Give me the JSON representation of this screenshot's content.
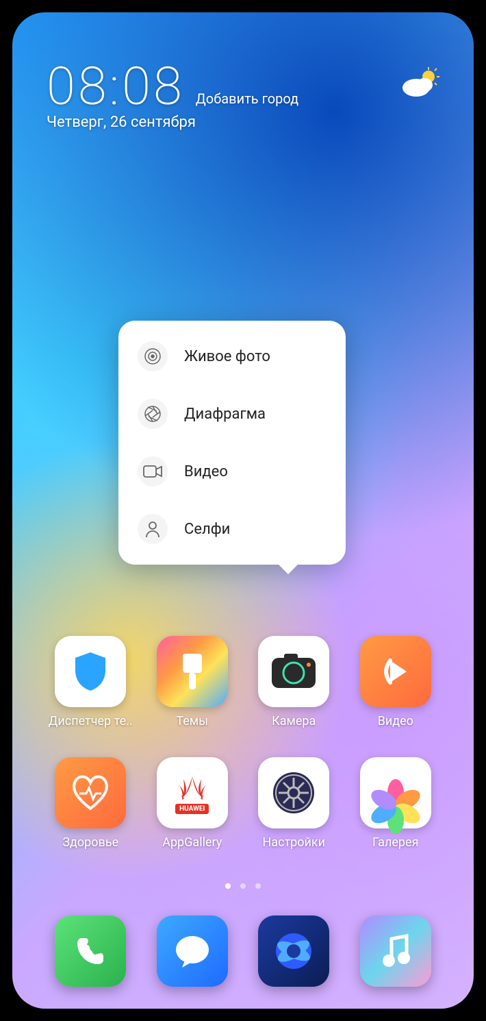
{
  "clock": {
    "time": "08:08",
    "add_city": "Добавить город",
    "date": "Четверг, 26 сентября"
  },
  "popover": {
    "items": [
      {
        "label": "Живое фото",
        "icon": "target-icon"
      },
      {
        "label": "Диафрагма",
        "icon": "aperture-icon"
      },
      {
        "label": "Видео",
        "icon": "video-icon"
      },
      {
        "label": "Селфи",
        "icon": "selfie-icon"
      }
    ]
  },
  "apps_row1": [
    {
      "label": "Диспетчер те..",
      "name": "app-phone-manager"
    },
    {
      "label": "Темы",
      "name": "app-themes"
    },
    {
      "label": "Камера",
      "name": "app-camera"
    },
    {
      "label": "Видео",
      "name": "app-video"
    }
  ],
  "apps_row2": [
    {
      "label": "Здоровье",
      "name": "app-health"
    },
    {
      "label": "AppGallery",
      "name": "app-appgallery"
    },
    {
      "label": "Настройки",
      "name": "app-settings"
    },
    {
      "label": "Галерея",
      "name": "app-gallery"
    }
  ],
  "dock": [
    {
      "name": "app-phone"
    },
    {
      "name": "app-messaging"
    },
    {
      "name": "app-browser"
    },
    {
      "name": "app-music"
    }
  ],
  "pages": {
    "count": 3,
    "active": 0
  }
}
